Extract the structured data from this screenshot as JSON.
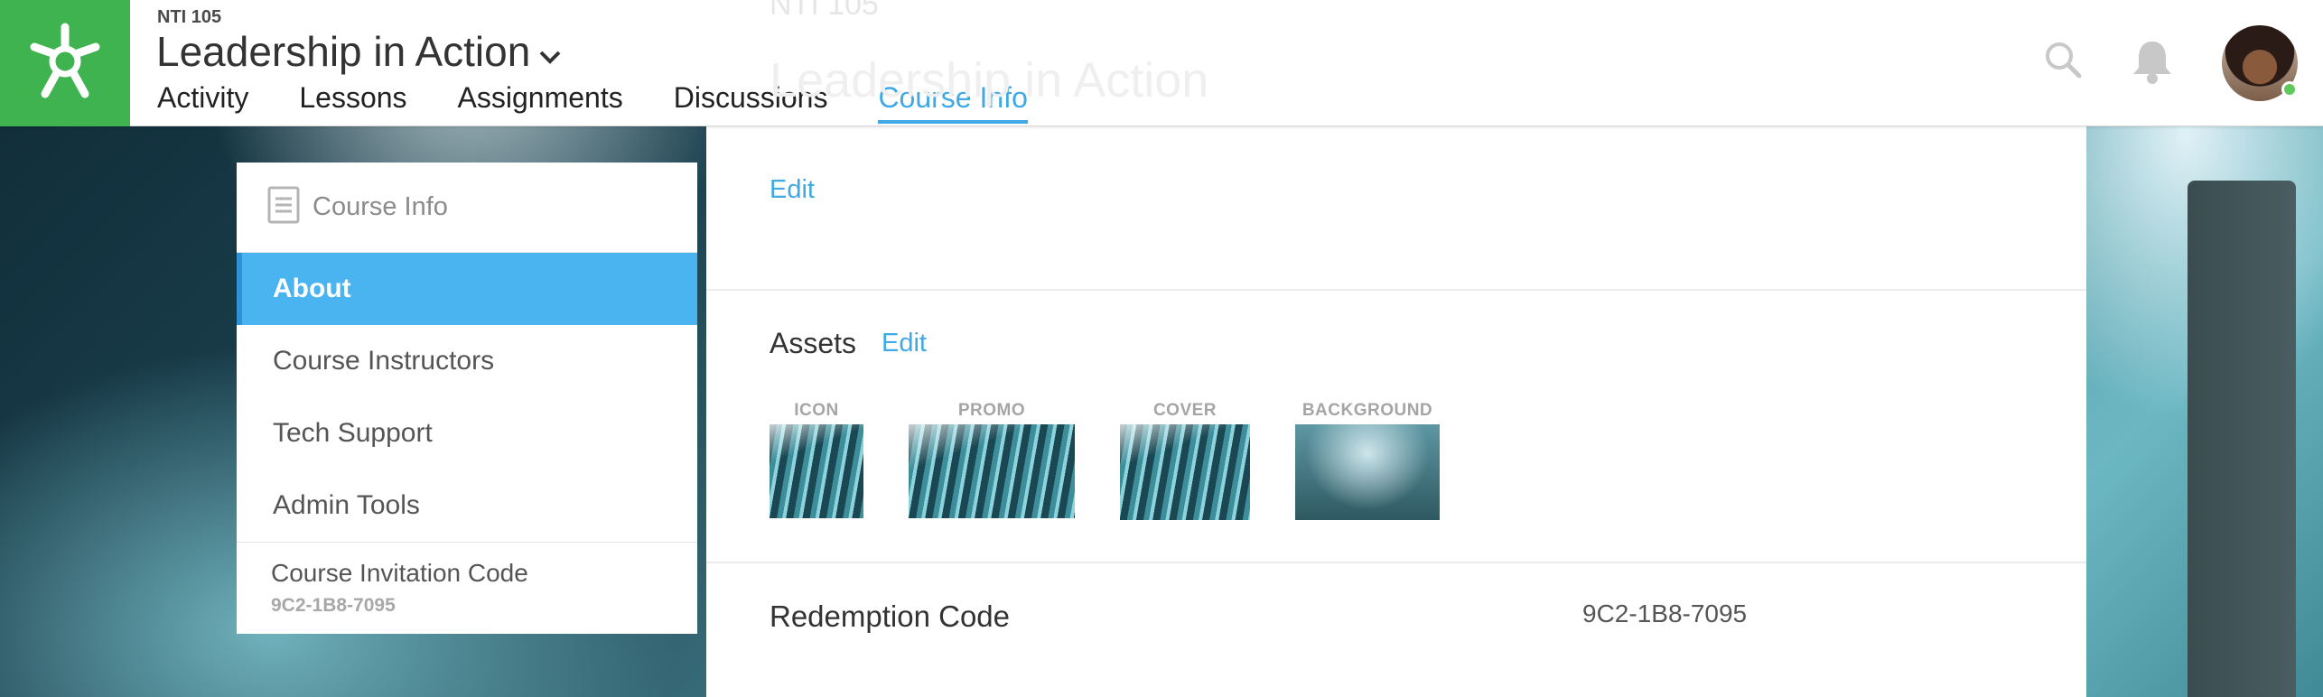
{
  "header": {
    "course_code": "NTI 105",
    "course_title": "Leadership in Action",
    "nav": [
      "Activity",
      "Lessons",
      "Assignments",
      "Discussions",
      "Course Info"
    ],
    "active_tab": "Course Info"
  },
  "faded": {
    "code": "NTI 105",
    "title": "Leadership in Action"
  },
  "sidebar": {
    "header_label": "Course Info",
    "items": [
      {
        "label": "About",
        "active": true
      },
      {
        "label": "Course Instructors",
        "active": false
      },
      {
        "label": "Tech Support",
        "active": false
      },
      {
        "label": "Admin Tools",
        "active": false
      }
    ],
    "invite_label": "Course Invitation Code",
    "invite_code": "9C2-1B8-7095"
  },
  "main": {
    "edit_label": "Edit",
    "assets_title": "Assets",
    "assets_edit": "Edit",
    "assets": [
      {
        "label": "ICON"
      },
      {
        "label": "PROMO"
      },
      {
        "label": "COVER"
      },
      {
        "label": "BACKGROUND"
      }
    ],
    "redemption_label": "Redemption Code",
    "redemption_value": "9C2-1B8-7095"
  },
  "colors": {
    "brand_green": "#3fb34f",
    "accent_blue": "#3fa9e6",
    "active_item": "#4ab4f0",
    "online_dot": "#5ec95a"
  },
  "icons": [
    "app-logo-icon",
    "chevron-down-icon",
    "search-icon",
    "bell-icon",
    "document-icon"
  ]
}
